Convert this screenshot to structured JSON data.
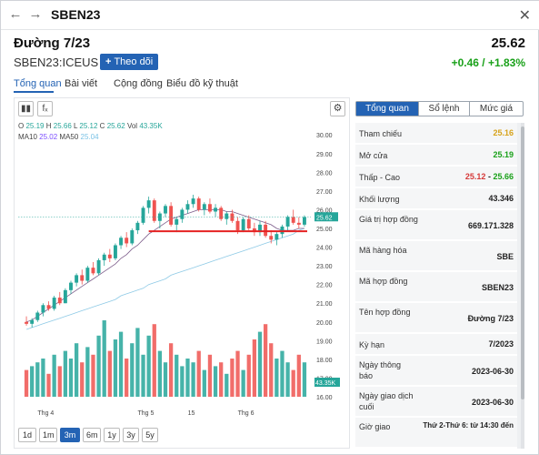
{
  "window": {
    "title": "SBEN23",
    "back_icon": "arrow-left-icon",
    "forward_icon": "arrow-right-icon",
    "close_icon": "close-icon"
  },
  "header": {
    "name": "Đường 7/23",
    "symbol": "SBEN23:ICEUS",
    "follow_label": "Theo dõi",
    "price": "25.62",
    "change": "+0.46 / +1.83%",
    "change_color": "#1aa11a"
  },
  "tabs": [
    "Tổng quan",
    "Bài viết",
    "Cộng đồng",
    "Biểu đồ kỹ thuật"
  ],
  "chart": {
    "legend": {
      "o": "25.19",
      "h": "25.66",
      "l": "25.12",
      "c": "25.62",
      "vol": "43.35K",
      "ma10": "25.02",
      "ma50": "25.04"
    },
    "legend_labels": {
      "o": "O",
      "h": "H",
      "l": "L",
      "c": "C",
      "vol": "Vol",
      "ma10": "MA10",
      "ma50": "MA50"
    },
    "price_ticks": [
      "30.00",
      "29.00",
      "28.00",
      "27.00",
      "26.00",
      "25.00",
      "24.00",
      "23.00",
      "22.00",
      "21.00",
      "20.00",
      "19.00",
      "18.00",
      "17.00",
      "16.00"
    ],
    "last_price_tag": "25.62",
    "volume_tag": "43.35K",
    "time_ticks": [
      "Thg 4",
      "Thg 5",
      "15",
      "Thg 6"
    ],
    "ranges": [
      "1d",
      "1m",
      "3m",
      "6m",
      "1y",
      "3y",
      "5y"
    ],
    "active_range": "3m",
    "colors": {
      "up": "#26a69a",
      "down": "#ef5350",
      "ma10": "#7c5c8a",
      "ma50": "#8ecae6",
      "support": "#e52222",
      "tag": "#26a69a"
    }
  },
  "chart_data": {
    "type": "candlestick",
    "y_range": [
      16,
      30.4
    ],
    "support_level": 24.85,
    "candles": [
      [
        20.0,
        20.3,
        19.8,
        19.9
      ],
      [
        19.9,
        20.2,
        19.7,
        20.1
      ],
      [
        20.1,
        20.6,
        20.0,
        20.5
      ],
      [
        20.5,
        21.0,
        20.3,
        20.9
      ],
      [
        20.9,
        21.1,
        20.6,
        20.7
      ],
      [
        20.7,
        21.4,
        20.6,
        21.3
      ],
      [
        21.3,
        21.6,
        20.9,
        21.0
      ],
      [
        21.0,
        21.8,
        21.0,
        21.7
      ],
      [
        21.7,
        22.2,
        21.5,
        22.1
      ],
      [
        22.1,
        22.6,
        21.9,
        22.5
      ],
      [
        22.5,
        22.8,
        22.0,
        22.2
      ],
      [
        22.2,
        23.0,
        22.1,
        22.9
      ],
      [
        22.9,
        23.2,
        22.5,
        22.6
      ],
      [
        22.6,
        23.4,
        22.5,
        23.3
      ],
      [
        23.3,
        23.7,
        23.0,
        23.6
      ],
      [
        23.6,
        23.9,
        23.2,
        23.4
      ],
      [
        23.4,
        24.2,
        23.3,
        24.1
      ],
      [
        24.1,
        24.6,
        23.9,
        24.5
      ],
      [
        24.5,
        24.8,
        24.0,
        24.2
      ],
      [
        24.2,
        25.0,
        24.1,
        24.9
      ],
      [
        24.9,
        25.4,
        24.7,
        25.3
      ],
      [
        25.3,
        26.2,
        25.2,
        26.1
      ],
      [
        26.1,
        26.7,
        25.8,
        26.5
      ],
      [
        26.5,
        26.6,
        25.3,
        25.4
      ],
      [
        25.4,
        25.9,
        25.0,
        25.8
      ],
      [
        25.8,
        26.3,
        25.6,
        26.2
      ],
      [
        26.2,
        26.4,
        25.1,
        25.2
      ],
      [
        25.2,
        25.6,
        24.8,
        25.5
      ],
      [
        25.5,
        26.1,
        25.3,
        26.0
      ],
      [
        26.0,
        26.5,
        25.8,
        26.3
      ],
      [
        26.3,
        26.8,
        26.1,
        26.6
      ],
      [
        26.6,
        26.7,
        25.9,
        26.0
      ],
      [
        26.0,
        26.4,
        25.7,
        26.3
      ],
      [
        26.3,
        26.6,
        25.8,
        25.9
      ],
      [
        25.9,
        26.3,
        25.6,
        26.1
      ],
      [
        26.1,
        26.2,
        25.4,
        25.5
      ],
      [
        25.5,
        25.9,
        25.2,
        25.8
      ],
      [
        25.8,
        26.0,
        25.3,
        25.4
      ],
      [
        25.4,
        25.6,
        24.7,
        24.9
      ],
      [
        24.9,
        25.6,
        24.8,
        25.5
      ],
      [
        25.5,
        25.7,
        24.9,
        25.0
      ],
      [
        25.0,
        25.3,
        24.6,
        24.8
      ],
      [
        24.8,
        25.4,
        24.6,
        25.2
      ],
      [
        25.2,
        25.4,
        24.5,
        24.6
      ],
      [
        24.6,
        24.9,
        24.2,
        24.4
      ],
      [
        24.4,
        24.8,
        24.1,
        24.7
      ],
      [
        24.7,
        25.2,
        24.5,
        25.1
      ],
      [
        25.1,
        25.7,
        24.9,
        25.6
      ],
      [
        25.6,
        26.0,
        25.2,
        25.3
      ],
      [
        25.3,
        25.6,
        25.0,
        25.2
      ],
      [
        25.2,
        25.7,
        25.1,
        25.6
      ]
    ],
    "ma10": [
      20.0,
      20.1,
      20.3,
      20.5,
      20.7,
      20.9,
      21.1,
      21.3,
      21.5,
      21.7,
      21.9,
      22.1,
      22.3,
      22.5,
      22.7,
      22.9,
      23.1,
      23.4,
      23.6,
      23.9,
      24.1,
      24.4,
      24.7,
      24.9,
      25.1,
      25.3,
      25.5,
      25.6,
      25.7,
      25.8,
      25.9,
      26.0,
      26.0,
      26.0,
      26.0,
      26.0,
      25.9,
      25.9,
      25.8,
      25.7,
      25.6,
      25.5,
      25.4,
      25.3,
      25.2,
      25.0,
      24.9,
      24.9,
      24.9,
      25.0,
      25.0
    ],
    "ma50": [
      19.6,
      19.7,
      19.8,
      19.9,
      20.0,
      20.1,
      20.2,
      20.3,
      20.4,
      20.5,
      20.6,
      20.7,
      20.8,
      20.9,
      21.0,
      21.1,
      21.2,
      21.4,
      21.5,
      21.6,
      21.7,
      21.8,
      22.0,
      22.1,
      22.2,
      22.3,
      22.5,
      22.6,
      22.7,
      22.8,
      22.9,
      23.0,
      23.1,
      23.2,
      23.3,
      23.4,
      23.5,
      23.6,
      23.7,
      23.8,
      23.9,
      24.0,
      24.1,
      24.2,
      24.3,
      24.4,
      24.5,
      24.6,
      24.7,
      24.9,
      25.0
    ],
    "volume": [
      0.35,
      0.4,
      0.45,
      0.5,
      0.3,
      0.55,
      0.4,
      0.6,
      0.5,
      0.7,
      0.45,
      0.65,
      0.55,
      0.8,
      1.0,
      0.6,
      0.75,
      0.85,
      0.5,
      0.7,
      0.9,
      0.55,
      0.8,
      0.95,
      0.6,
      0.45,
      0.7,
      0.55,
      0.4,
      0.5,
      0.45,
      0.6,
      0.35,
      0.55,
      0.4,
      0.45,
      0.3,
      0.5,
      0.6,
      0.35,
      0.55,
      0.75,
      0.85,
      0.95,
      0.7,
      0.5,
      0.6,
      0.45,
      0.35,
      0.55,
      0.45
    ]
  },
  "info": {
    "segments": [
      "Tổng quan",
      "Sổ lệnh",
      "Mức giá"
    ],
    "rows": [
      {
        "label": "Tham chiếu",
        "value": "25.16",
        "color": "yellow"
      },
      {
        "label": "Mở cửa",
        "value": "25.19",
        "color": "green"
      },
      {
        "label": "Thấp - Cao",
        "low": "25.12",
        "sep": "-",
        "high": "25.66"
      },
      {
        "label": "Khối lượng",
        "value": "43.346"
      },
      {
        "label": "Giá trị hợp đồng",
        "value": "669.171.328"
      },
      {
        "label": "Mã hàng hóa",
        "value": "SBE"
      },
      {
        "label": "Mã hợp đồng",
        "value": "SBEN23"
      },
      {
        "label": "Tên hợp đồng",
        "value": "Đường 7/23"
      },
      {
        "label": "Kỳ hạn",
        "value": "7/2023"
      },
      {
        "label": "Ngày thông báo",
        "value": "2023-06-30"
      },
      {
        "label": "Ngày giao dịch cuối",
        "value": "2023-06-30"
      },
      {
        "label": "Giờ giao",
        "value": "Thứ 2-Thứ 6: từ 14:30 đến"
      }
    ]
  }
}
